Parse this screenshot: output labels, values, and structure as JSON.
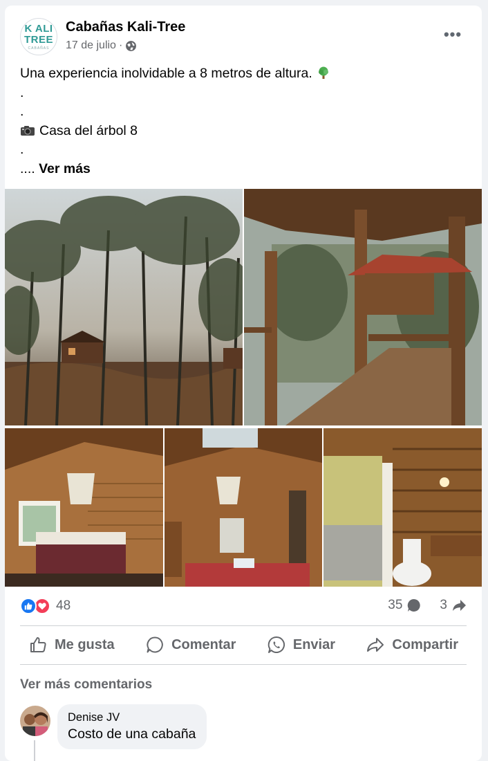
{
  "post": {
    "page_name": "Cabañas Kali-Tree",
    "date": "17 de julio",
    "separator": "·",
    "more_label": "•••",
    "logo": {
      "line1": "K ALI",
      "line2": "TREE",
      "line3": "CABAÑAS"
    },
    "text_lines": [
      "Una experiencia inolvidable a 8 metros de altura.",
      ".",
      ".",
      "Casa del árbol 8",
      "."
    ],
    "text_prefix": "....",
    "see_more": "Ver más"
  },
  "photos": [
    {
      "name": "photo-treehouse-forest"
    },
    {
      "name": "photo-bridge-walkway"
    },
    {
      "name": "photo-bedroom-1"
    },
    {
      "name": "photo-bedroom-2"
    },
    {
      "name": "photo-bathroom"
    }
  ],
  "stats": {
    "reaction_count": "48",
    "comment_count": "35",
    "share_count": "3",
    "reactions": [
      "like-icon",
      "love-icon"
    ]
  },
  "actions": {
    "like": "Me gusta",
    "comment": "Comentar",
    "send": "Enviar",
    "share": "Compartir"
  },
  "comments": {
    "view_more": "Ver más comentarios",
    "items": [
      {
        "author": "Denise JV",
        "text": "Costo de una cabaña"
      }
    ]
  },
  "colors": {
    "accent": "#1877f2",
    "love": "#f33e58",
    "secondary_text": "#65676b",
    "logo": "#2f9a95"
  }
}
